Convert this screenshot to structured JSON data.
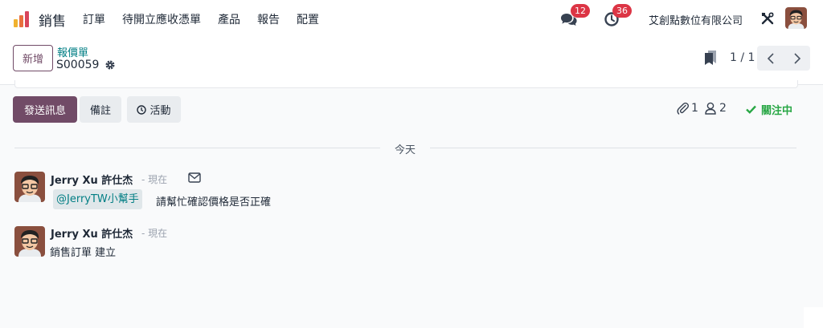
{
  "navbar": {
    "app_name": "銷售",
    "menu": [
      "訂單",
      "待開立應收憑單",
      "產品",
      "報告",
      "配置"
    ],
    "messages_count": "12",
    "activities_count": "36",
    "company": "艾創點數位有限公司",
    "logo_icon": "sales-app-icon",
    "debug_icon": "debug-tools-icon",
    "avatar_icon": "user-avatar"
  },
  "control": {
    "new_label": "新增",
    "breadcrumb_parent": "報價單",
    "breadcrumb_current": "S00059",
    "pager_value": "1 / 1"
  },
  "chatter": {
    "send_label": "發送訊息",
    "note_label": "備註",
    "activity_label": "活動",
    "attachments_count": "1",
    "followers_count": "2",
    "follow_label": "關注中",
    "date_divider": "今天",
    "messages": [
      {
        "author": "Jerry Xu 許仕杰",
        "time": "- 現在",
        "mention": "@JerryTW小幫手",
        "body": "請幫忙確認價格是否正確"
      },
      {
        "author": "Jerry Xu 許仕杰",
        "time": "- 現在",
        "body": "銷售訂單 建立"
      }
    ]
  },
  "colors": {
    "brand": "#714b67",
    "link": "#017e84",
    "badge": "#dc3545",
    "follow": "#28a745"
  }
}
